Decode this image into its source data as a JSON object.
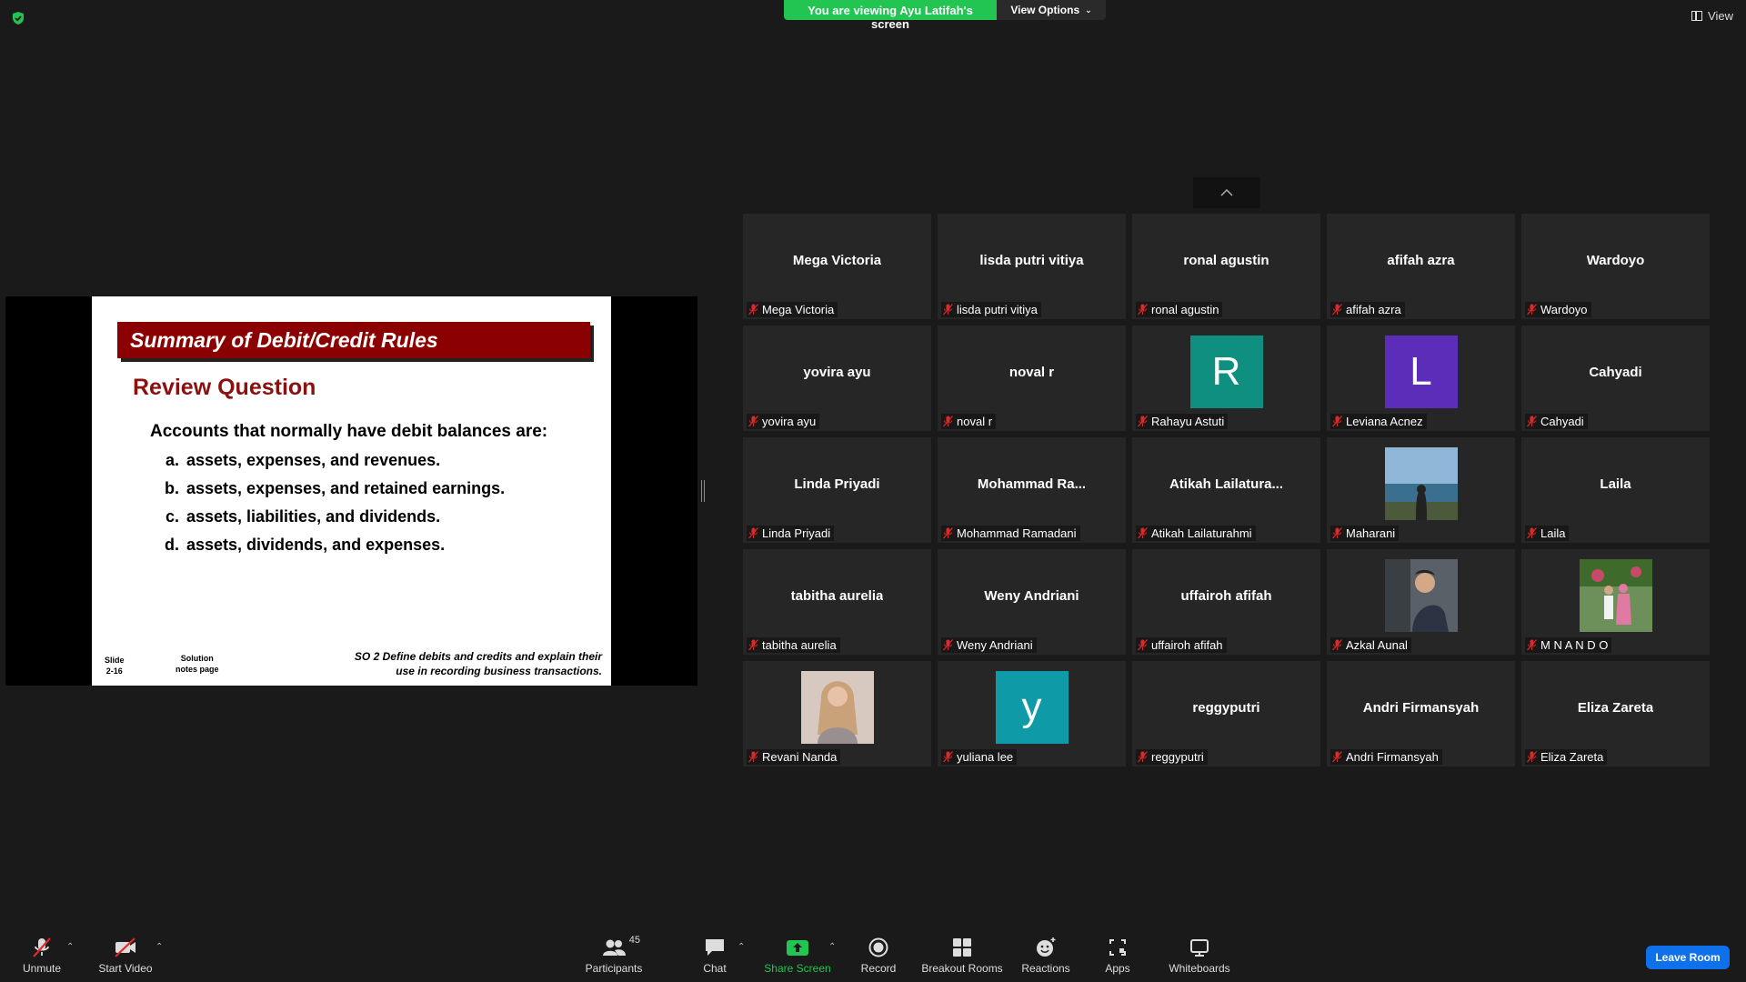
{
  "banner": {
    "viewing": "You are viewing Ayu Latifah's screen",
    "view_options": "View Options"
  },
  "view_button": "View",
  "slide": {
    "title": "Summary of Debit/Credit Rules",
    "subtitle": "Review Question",
    "question": "Accounts that normally have debit balances are:",
    "options": [
      {
        "letter": "a.",
        "text": "assets, expenses, and revenues."
      },
      {
        "letter": "b.",
        "text": "assets, expenses, and retained earnings."
      },
      {
        "letter": "c.",
        "text": "assets, liabilities, and dividends."
      },
      {
        "letter": "d.",
        "text": "assets, dividends, and expenses."
      }
    ],
    "footer_slide": "Slide",
    "footer_num": "2-16",
    "footer_solution": "Solution",
    "footer_notes": "notes page",
    "footer_so_line1": "SO 2  Define debits and credits and explain their",
    "footer_so_line2": "use in recording business transactions."
  },
  "participants": [
    {
      "display": "Mega Victoria",
      "label": "Mega Victoria",
      "kind": "name"
    },
    {
      "display": "lisda putri vitiya",
      "label": "lisda putri vitiya",
      "kind": "name"
    },
    {
      "display": "ronal agustin",
      "label": "ronal agustin",
      "kind": "name"
    },
    {
      "display": "afifah azra",
      "label": "afifah azra",
      "kind": "name"
    },
    {
      "display": "Wardoyo",
      "label": "Wardoyo",
      "kind": "name"
    },
    {
      "display": "yovira ayu",
      "label": "yovira ayu",
      "kind": "name"
    },
    {
      "display": "noval r",
      "label": "noval r",
      "kind": "name"
    },
    {
      "display": "R",
      "label": "Rahayu Astuti",
      "kind": "avatar",
      "color": "#0e8f7f"
    },
    {
      "display": "L",
      "label": "Leviana Acnez",
      "kind": "avatar",
      "color": "#5b2db8"
    },
    {
      "display": "Cahyadi",
      "label": "Cahyadi",
      "kind": "name"
    },
    {
      "display": "Linda Priyadi",
      "label": "Linda Priyadi",
      "kind": "name"
    },
    {
      "display": "Mohammad  Ra...",
      "label": "Mohammad Ramadani",
      "kind": "name"
    },
    {
      "display": "Atikah  Lailatura...",
      "label": "Atikah Lailaturahmi",
      "kind": "name"
    },
    {
      "display": "",
      "label": "Maharani",
      "kind": "photo",
      "photo": "sea"
    },
    {
      "display": "Laila",
      "label": "Laila",
      "kind": "name"
    },
    {
      "display": "tabitha aurelia",
      "label": "tabitha aurelia",
      "kind": "name"
    },
    {
      "display": "Weny Andriani",
      "label": "Weny Andriani",
      "kind": "name"
    },
    {
      "display": "uffairoh afifah",
      "label": "uffairoh afifah",
      "kind": "name"
    },
    {
      "display": "",
      "label": "Azkal Aunal",
      "kind": "photo",
      "photo": "man"
    },
    {
      "display": "",
      "label": "M N A N D O",
      "kind": "photo",
      "photo": "couple"
    },
    {
      "display": "",
      "label": "Revani Nanda",
      "kind": "photo",
      "photo": "woman"
    },
    {
      "display": "y",
      "label": "yuliana lee",
      "kind": "avatar",
      "color": "#0e9aa7"
    },
    {
      "display": "reggyputri",
      "label": "reggyputri",
      "kind": "name"
    },
    {
      "display": "Andri Firmansyah",
      "label": "Andri Firmansyah",
      "kind": "name"
    },
    {
      "display": "Eliza Zareta",
      "label": "Eliza Zareta",
      "kind": "name"
    }
  ],
  "toolbar": {
    "unmute": "Unmute",
    "start_video": "Start Video",
    "participants": "Participants",
    "participants_count": "45",
    "chat": "Chat",
    "share_screen": "Share Screen",
    "record": "Record",
    "breakout_rooms": "Breakout Rooms",
    "reactions": "Reactions",
    "apps": "Apps",
    "whiteboards": "Whiteboards",
    "leave_room": "Leave Room"
  },
  "colors": {
    "accent_green": "#23c552",
    "leave_blue": "#0e71eb",
    "slide_red": "#8b0000"
  }
}
